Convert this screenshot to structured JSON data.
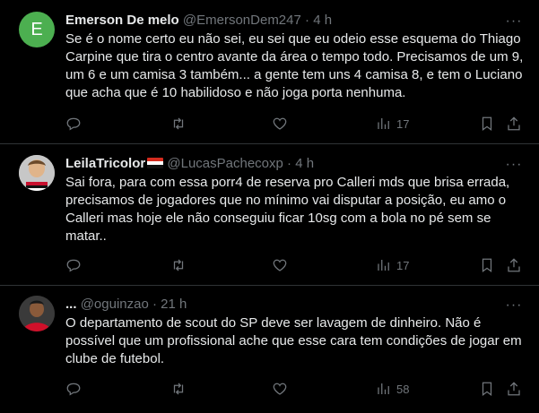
{
  "tweets": [
    {
      "avatar_letter": "E",
      "avatar_color": "#4caf50",
      "name": "Emerson De melo",
      "handle": "@EmersonDem247",
      "time": "4 h",
      "text": "Se é o nome certo eu não sei, eu sei que eu odeio esse esquema do Thiago Carpine que tira o centro avante da área o tempo todo. Precisamos de um 9, um 6 e um camisa 3 também... a gente tem uns 4 camisa 8, e tem o Luciano que acha que é 10 habilidoso e não joga porta nenhuma.",
      "views": "17"
    },
    {
      "name": "LeilaTricolor",
      "handle": "@LucasPachecoxp",
      "time": "4 h",
      "text": "Sai fora, para com essa porr4 de reserva pro Calleri mds que brisa errada, precisamos de jogadores que no mínimo vai disputar a posição, eu amo o Calleri mas hoje ele não conseguiu ficar 10sg com a bola no pé sem se matar..",
      "views": "17"
    },
    {
      "name": "...",
      "handle": "@oguinzao",
      "time": "21 h",
      "text": "O departamento de scout do SP deve ser lavagem de dinheiro. Não é possível que um profissional ache que esse cara tem condições de jogar em clube de futebol.",
      "views": "58"
    }
  ],
  "separator": "·",
  "more_label": "···",
  "icons": [
    "reply-icon",
    "retweet-icon",
    "like-icon",
    "views-icon",
    "bookmark-icon",
    "share-icon",
    "more-icon",
    "flag-icon"
  ]
}
